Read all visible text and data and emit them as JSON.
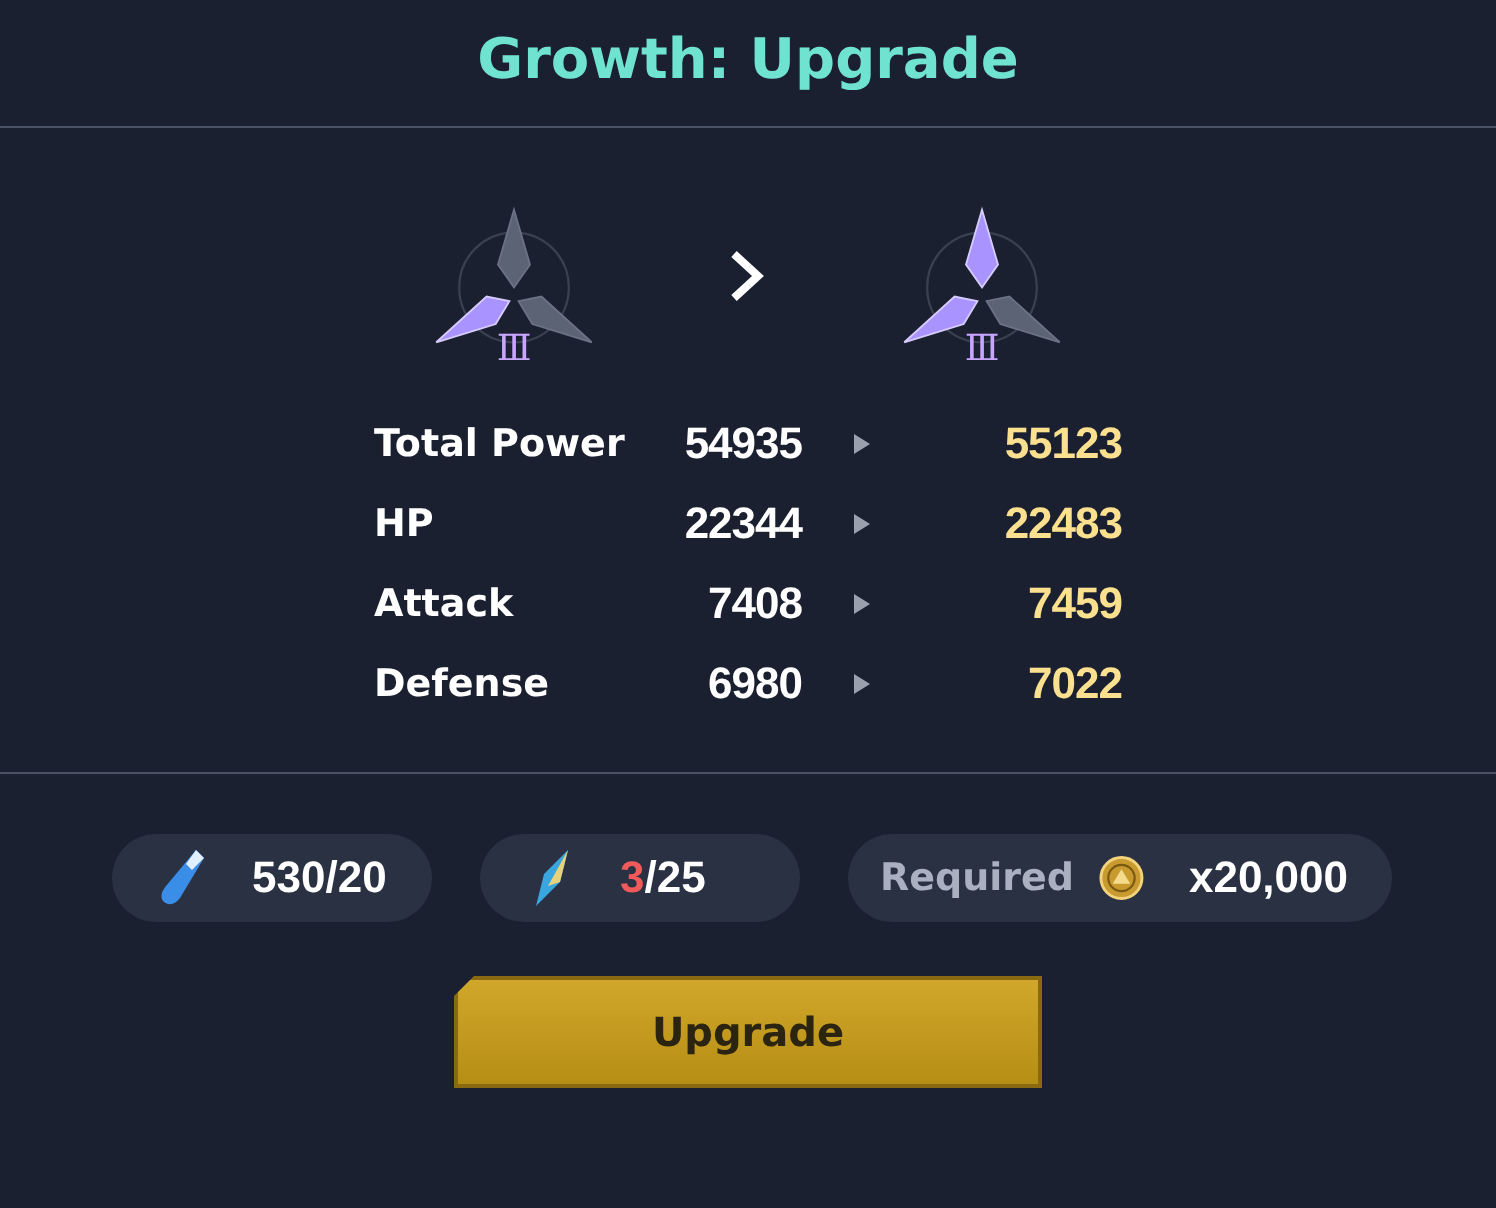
{
  "title": "Growth: Upgrade",
  "emblems": [
    {
      "tier": "Ⅲ",
      "blades": [
        {
          "lit": false
        },
        {
          "lit": true
        },
        {
          "lit": false
        }
      ]
    },
    {
      "tier": "Ⅲ",
      "blades": [
        {
          "lit": true
        },
        {
          "lit": true
        },
        {
          "lit": false
        }
      ]
    }
  ],
  "stats": [
    {
      "label": "Total Power",
      "current": "54935",
      "next": "55123"
    },
    {
      "label": "HP",
      "current": "22344",
      "next": "22483"
    },
    {
      "label": "Attack",
      "current": "7408",
      "next": "7459"
    },
    {
      "label": "Defense",
      "current": "6980",
      "next": "7022"
    }
  ],
  "resources": [
    {
      "kind": "potion",
      "have": "530",
      "need": "/20",
      "sufficient": true
    },
    {
      "kind": "shard",
      "have": "3",
      "need": "/25",
      "sufficient": false
    },
    {
      "kind": "gold",
      "label": "Required",
      "amount": "x20,000"
    }
  ],
  "button": "Upgrade"
}
